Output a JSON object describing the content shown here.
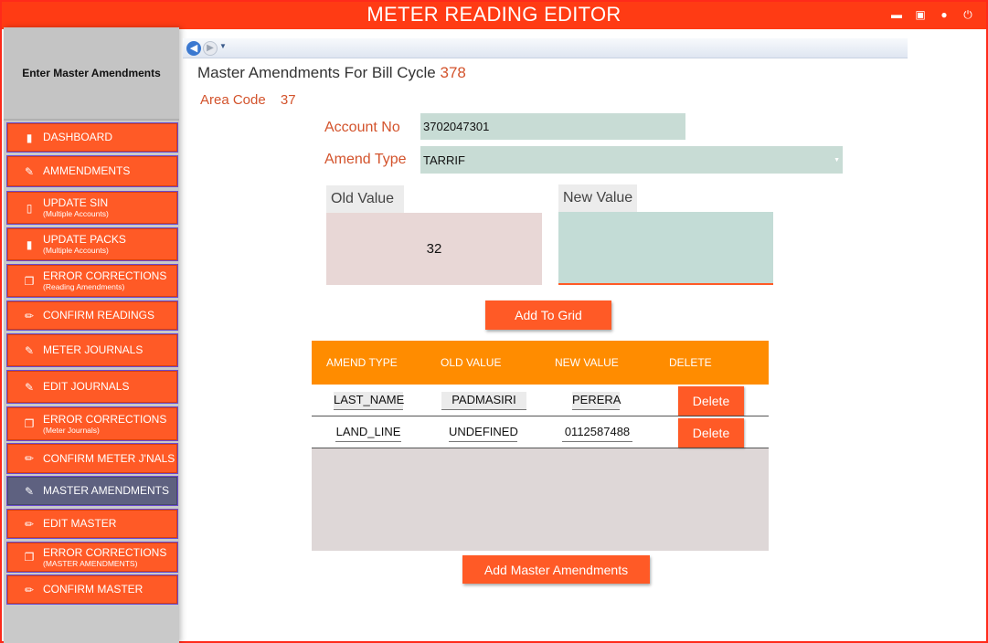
{
  "window": {
    "title": "METER READING EDITOR"
  },
  "window_controls": [
    "minimize-icon",
    "maximize-icon",
    "user-icon",
    "power-icon"
  ],
  "sidebar": {
    "header": "Enter Master Amendments",
    "items": [
      {
        "label": "DASHBOARD",
        "sub": "",
        "icon": "book-icon",
        "active": false
      },
      {
        "label": "AMMENDMENTS",
        "sub": "",
        "icon": "user-edit-icon",
        "active": false
      },
      {
        "label": "UPDATE SIN",
        "sub": "(Multiple Accounts)",
        "icon": "document-icon",
        "active": false
      },
      {
        "label": "UPDATE PACKS",
        "sub": "(Multiple Accounts)",
        "icon": "book-icon",
        "active": false
      },
      {
        "label": "ERROR CORRECTIONS",
        "sub": "(Reading Amendments)",
        "icon": "documents-icon",
        "active": false
      },
      {
        "label": "CONFIRM READINGS",
        "sub": "",
        "icon": "pencil-icon",
        "active": false
      },
      {
        "label": "METER JOURNALS",
        "sub": "",
        "icon": "user-edit-icon",
        "active": false
      },
      {
        "label": "EDIT JOURNALS",
        "sub": "",
        "icon": "user-edit-icon",
        "active": false
      },
      {
        "label": "ERROR CORRECTIONS",
        "sub": "(Meter Journals)",
        "icon": "documents-icon",
        "active": false
      },
      {
        "label": "CONFIRM METER J'NALS",
        "sub": "",
        "icon": "pencil-icon",
        "active": false
      },
      {
        "label": "MASTER AMENDMENTS",
        "sub": "",
        "icon": "user-edit-icon",
        "active": true
      },
      {
        "label": "EDIT MASTER",
        "sub": "",
        "icon": "pencil-icon",
        "active": false
      },
      {
        "label": "ERROR CORRECTIONS",
        "sub": "(MASTER AMENDMENTS)",
        "icon": "documents-icon",
        "active": false
      },
      {
        "label": "CONFIRM MASTER",
        "sub": "",
        "icon": "pencil-icon",
        "active": false
      }
    ]
  },
  "main": {
    "title_prefix": "Master Amendments For Bill Cycle",
    "bill_cycle": "378",
    "area_label": "Area Code",
    "area_code": "37",
    "account_label": "Account No",
    "account_value": "3702047301",
    "amend_type_label": "Amend Type",
    "amend_type_value": "TARRIF",
    "old_value_label": "Old Value",
    "old_value": "32",
    "new_value_label": "New Value",
    "new_value": "",
    "add_to_grid": "Add To Grid",
    "add_master": "Add Master Amendments"
  },
  "grid": {
    "headers": [
      "AMEND TYPE",
      "OLD VALUE",
      "NEW VALUE",
      "DELETE"
    ],
    "rows": [
      {
        "amend_type": "LAST_NAME",
        "old_value": "PADMASIRI",
        "new_value": "PERERA",
        "delete": "Delete"
      },
      {
        "amend_type": "LAND_LINE",
        "old_value": "UNDEFINED",
        "new_value": "0112587488",
        "delete": "Delete"
      }
    ]
  }
}
